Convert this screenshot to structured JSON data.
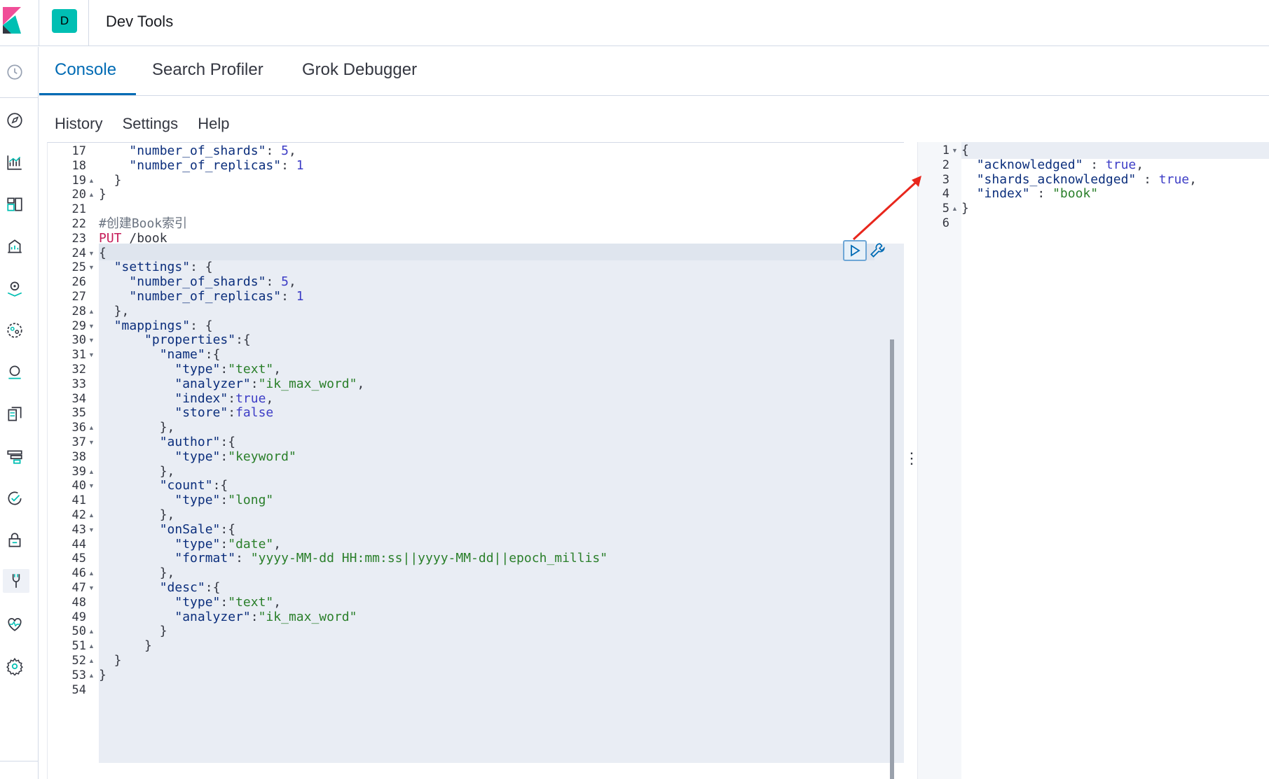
{
  "header": {
    "space_initial": "D",
    "app_title": "Dev Tools"
  },
  "tabs": [
    {
      "label": "Console",
      "active": true
    },
    {
      "label": "Search Profiler",
      "active": false
    },
    {
      "label": "Grok Debugger",
      "active": false
    }
  ],
  "toolbar": {
    "history": "History",
    "settings": "Settings",
    "help": "Help"
  },
  "nav_icons": [
    "recent-icon",
    "discover-icon",
    "visualize-icon",
    "dashboard-icon",
    "canvas-icon",
    "maps-icon",
    "ml-icon",
    "infrastructure-icon",
    "logs-icon",
    "apm-icon",
    "uptime-icon",
    "security-icon",
    "dev-tools-icon",
    "monitoring-icon",
    "management-icon"
  ],
  "editor": {
    "lines": [
      {
        "n": "17",
        "fold": "",
        "text": "    \"number_of_shards\": 5,"
      },
      {
        "n": "18",
        "fold": "",
        "text": "    \"number_of_replicas\": 1"
      },
      {
        "n": "19",
        "fold": "up",
        "text": "  }"
      },
      {
        "n": "20",
        "fold": "up",
        "text": "}"
      },
      {
        "n": "21",
        "fold": "",
        "text": ""
      },
      {
        "n": "22",
        "fold": "",
        "text": "#创建Book索引"
      },
      {
        "n": "23",
        "fold": "",
        "text": "PUT /book"
      },
      {
        "n": "24",
        "fold": "down",
        "text": "{"
      },
      {
        "n": "25",
        "fold": "down",
        "text": "  \"settings\": {"
      },
      {
        "n": "26",
        "fold": "",
        "text": "    \"number_of_shards\": 5,"
      },
      {
        "n": "27",
        "fold": "",
        "text": "    \"number_of_replicas\": 1"
      },
      {
        "n": "28",
        "fold": "up",
        "text": "  },"
      },
      {
        "n": "29",
        "fold": "down",
        "text": "  \"mappings\": {"
      },
      {
        "n": "30",
        "fold": "down",
        "text": "      \"properties\":{"
      },
      {
        "n": "31",
        "fold": "down",
        "text": "        \"name\":{"
      },
      {
        "n": "32",
        "fold": "",
        "text": "          \"type\":\"text\","
      },
      {
        "n": "33",
        "fold": "",
        "text": "          \"analyzer\":\"ik_max_word\","
      },
      {
        "n": "34",
        "fold": "",
        "text": "          \"index\":true,"
      },
      {
        "n": "35",
        "fold": "",
        "text": "          \"store\":false"
      },
      {
        "n": "36",
        "fold": "up",
        "text": "        },"
      },
      {
        "n": "37",
        "fold": "down",
        "text": "        \"author\":{"
      },
      {
        "n": "38",
        "fold": "",
        "text": "          \"type\":\"keyword\""
      },
      {
        "n": "39",
        "fold": "up",
        "text": "        },"
      },
      {
        "n": "40",
        "fold": "down",
        "text": "        \"count\":{"
      },
      {
        "n": "41",
        "fold": "",
        "text": "          \"type\":\"long\""
      },
      {
        "n": "42",
        "fold": "up",
        "text": "        },"
      },
      {
        "n": "43",
        "fold": "down",
        "text": "        \"onSale\":{"
      },
      {
        "n": "44",
        "fold": "",
        "text": "          \"type\":\"date\","
      },
      {
        "n": "45",
        "fold": "",
        "text": "          \"format\": \"yyyy-MM-dd HH:mm:ss||yyyy-MM-dd||epoch_millis\""
      },
      {
        "n": "46",
        "fold": "up",
        "text": "        },"
      },
      {
        "n": "47",
        "fold": "down",
        "text": "        \"desc\":{"
      },
      {
        "n": "48",
        "fold": "",
        "text": "          \"type\":\"text\","
      },
      {
        "n": "49",
        "fold": "",
        "text": "          \"analyzer\":\"ik_max_word\""
      },
      {
        "n": "50",
        "fold": "up",
        "text": "        }"
      },
      {
        "n": "51",
        "fold": "up",
        "text": "      }"
      },
      {
        "n": "52",
        "fold": "up",
        "text": "  }"
      },
      {
        "n": "53",
        "fold": "up",
        "text": "}"
      },
      {
        "n": "54",
        "fold": "",
        "text": ""
      }
    ]
  },
  "output": {
    "lines": [
      {
        "n": "1",
        "fold": "down",
        "text": "{"
      },
      {
        "n": "2",
        "fold": "",
        "text": "  \"acknowledged\" : true,"
      },
      {
        "n": "3",
        "fold": "",
        "text": "  \"shards_acknowledged\" : true,"
      },
      {
        "n": "4",
        "fold": "",
        "text": "  \"index\" : \"book\""
      },
      {
        "n": "5",
        "fold": "up",
        "text": "}"
      },
      {
        "n": "6",
        "fold": "",
        "text": ""
      }
    ]
  },
  "colors": {
    "accent": "#006bb4",
    "string": "#2a7f2a",
    "key": "#0b2e7c",
    "bool": "#3d3dc6",
    "method": "#c61c59",
    "comment": "#6a7380",
    "arrow": "#e8261c"
  }
}
